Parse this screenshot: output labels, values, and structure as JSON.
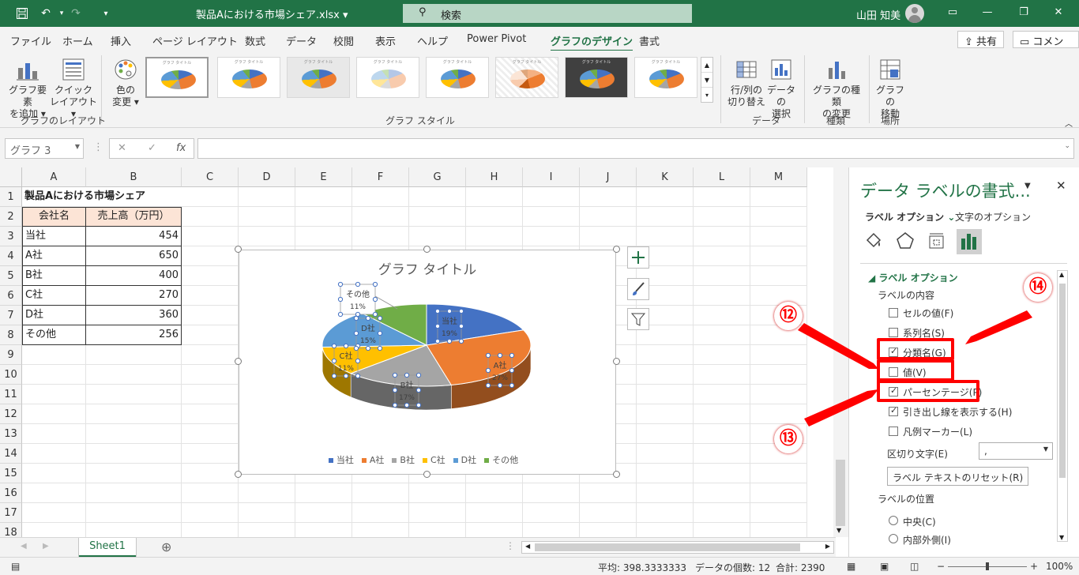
{
  "titlebar": {
    "doc_title": "製品Aにおける市場シェア.xlsx",
    "search_placeholder": "検索",
    "user_name": "山田 知美"
  },
  "menu": [
    "ファイル",
    "ホーム",
    "挿入",
    "ページ レイアウト",
    "数式",
    "データ",
    "校閲",
    "表示",
    "ヘルプ",
    "Power Pivot",
    "グラフのデザイン",
    "書式"
  ],
  "menu_active": "グラフのデザイン",
  "share_label": "共有",
  "comment_label": "コメント",
  "ribbon": {
    "add_element": [
      "グラフ要素",
      "を追加"
    ],
    "quick_layout": [
      "クイック",
      "レイアウト"
    ],
    "change_color": [
      "色の",
      "変更"
    ],
    "switch_rowcol": [
      "行/列の",
      "切り替え"
    ],
    "select_data": [
      "データの",
      "選択"
    ],
    "change_type": [
      "グラフの種類",
      "の変更"
    ],
    "move_chart": [
      "グラフの",
      "移動"
    ],
    "groups": {
      "layout": "グラフのレイアウト",
      "style": "グラフ スタイル",
      "data": "データ",
      "type": "種類",
      "location": "場所"
    }
  },
  "name_box": "グラフ 3",
  "columns": [
    "A",
    "B",
    "C",
    "D",
    "E",
    "F",
    "G",
    "H",
    "I",
    "J",
    "K",
    "L",
    "M"
  ],
  "rows": [
    "1",
    "2",
    "3",
    "4",
    "5",
    "6",
    "7",
    "8",
    "9",
    "10",
    "11",
    "12",
    "13",
    "14",
    "15",
    "16",
    "17",
    "18"
  ],
  "sheet": {
    "title": "製品Aにおける市場シェア",
    "header": [
      "会社名",
      "売上高（万円）"
    ],
    "data": [
      [
        "当社",
        "454"
      ],
      [
        "A社",
        "650"
      ],
      [
        "B社",
        "400"
      ],
      [
        "C社",
        "270"
      ],
      [
        "D社",
        "360"
      ],
      [
        "その他",
        "256"
      ]
    ]
  },
  "chart_data": {
    "type": "pie",
    "title": "グラフ タイトル",
    "categories": [
      "当社",
      "A社",
      "B社",
      "C社",
      "D社",
      "その他"
    ],
    "values": [
      454,
      650,
      400,
      270,
      360,
      256
    ],
    "percent_labels": [
      "19%",
      "27%",
      "17%",
      "11%",
      "15%",
      "11%"
    ],
    "colors": [
      "#4472c4",
      "#ed7d31",
      "#a5a5a5",
      "#ffc000",
      "#5b9bd5",
      "#70ad47"
    ],
    "legend": "bottom"
  },
  "sheet_tab": "Sheet1",
  "status": {
    "average": "平均: 398.3333333",
    "count": "データの個数: 12",
    "sum": "合計: 2390",
    "zoom": "100%"
  },
  "pane": {
    "title": "データ ラベルの書式...",
    "tab_label_options": "ラベル オプション",
    "tab_text_options": "文字のオプション",
    "section": "ラベル オプション",
    "content_heading": "ラベルの内容",
    "options": [
      {
        "label": "セルの値(F)",
        "checked": false
      },
      {
        "label": "系列名(S)",
        "checked": false
      },
      {
        "label": "分類名(G)",
        "checked": true
      },
      {
        "label": "値(V)",
        "checked": false
      },
      {
        "label": "パーセンテージ(P)",
        "checked": true
      },
      {
        "label": "引き出し線を表示する(H)",
        "checked": true
      },
      {
        "label": "凡例マーカー(L)",
        "checked": false
      }
    ],
    "separator_label": "区切り文字(E)",
    "separator_value": ",",
    "reset_button": "ラベル テキストのリセット(R)",
    "position_heading": "ラベルの位置",
    "positions": [
      "中央(C)",
      "内部外側(I)"
    ]
  },
  "annotations": [
    "⑫",
    "⑬",
    "⑭"
  ]
}
